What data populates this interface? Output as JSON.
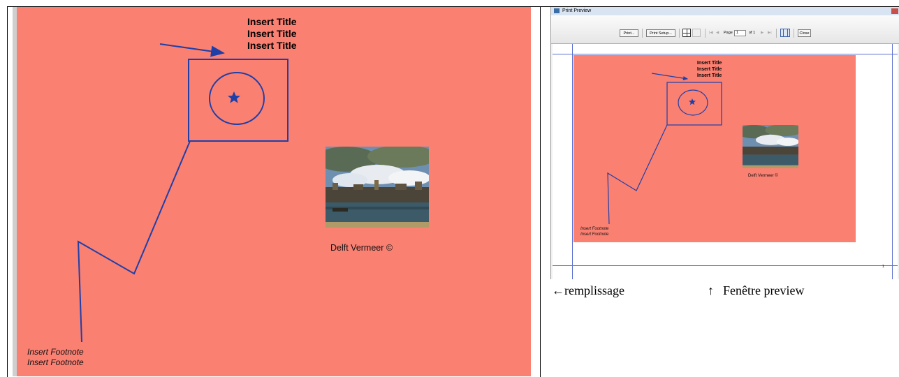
{
  "document": {
    "titles": [
      "Insert Title",
      "Insert Title",
      "Insert Title"
    ],
    "footnotes": [
      "Insert Footnote",
      "Insert Footnote"
    ],
    "painting_caption": "Delft Vermeer ©",
    "fill_color": "#fa8072",
    "drawing_color": "#1f3fa8"
  },
  "preview_window": {
    "title": "Print Preview",
    "toolbar": {
      "print_label": "Print...",
      "print_setup_label": "Print Setup...",
      "page_label": "Page",
      "page_value": "1",
      "of_label": "of 1",
      "close_label": "Close"
    },
    "page_number": "1"
  },
  "captions": {
    "left_arrow": "←",
    "left_text": "remplissage",
    "up_arrow": "↑",
    "right_text": "Fenêtre preview"
  },
  "icons": [
    "window-icon",
    "close-icon",
    "single-page-icon",
    "multi-page-icon",
    "first-page-icon",
    "prev-page-icon",
    "next-page-icon",
    "last-page-icon",
    "fit-page-icon",
    "star-icon",
    "left-arrow-icon",
    "up-arrow-icon"
  ]
}
